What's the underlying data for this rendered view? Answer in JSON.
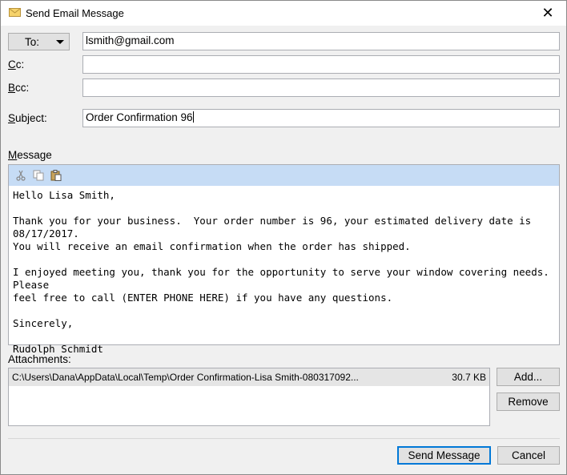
{
  "window": {
    "title": "Send Email Message",
    "close_glyph": "✕"
  },
  "recipients": {
    "to_button": "To:",
    "to_value": "lsmith@gmail.com",
    "cc_label_accel": "C",
    "cc_label_rest": "c:",
    "cc_value": "",
    "bcc_label_accel": "B",
    "bcc_label_rest": "cc:",
    "bcc_value": ""
  },
  "subject": {
    "label_accel": "S",
    "label_rest": "ubject:",
    "value": "Order Confirmation 96"
  },
  "message": {
    "label_accel": "M",
    "label_rest": "essage",
    "toolbar": [
      "cut-icon",
      "copy-icon",
      "paste-icon"
    ],
    "body": "Hello Lisa Smith,\n\nThank you for your business.  Your order number is 96, your estimated delivery date is 08/17/2017.\nYou will receive an email confirmation when the order has shipped.\n\nI enjoyed meeting you, thank you for the opportunity to serve your window covering needs.  Please\nfeel free to call (ENTER PHONE HERE) if you have any questions.\n\nSincerely,\n\nRudolph Schmidt"
  },
  "attachments": {
    "label": "Attachments:",
    "items": [
      {
        "path": "C:\\Users\\Dana\\AppData\\Local\\Temp\\Order Confirmation-Lisa Smith-080317092...",
        "size": "30.7 KB"
      }
    ],
    "add_label": "Add...",
    "remove_label": "Remove"
  },
  "footer": {
    "send_label": "Send Message",
    "cancel_label": "Cancel"
  },
  "colors": {
    "toolbar_bg": "#c6dcf5",
    "default_button_border": "#0078d7"
  }
}
